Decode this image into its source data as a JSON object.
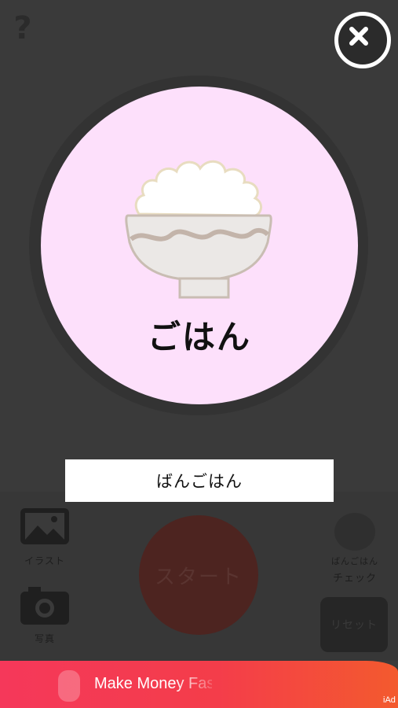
{
  "header": {
    "help_symbol": "?",
    "close_icon": "close-icon"
  },
  "card": {
    "word": "ごはん",
    "image": "rice-bowl-illustration",
    "background": "#fde0fb"
  },
  "answer_box": {
    "text": "ばんごはん"
  },
  "controls": {
    "illustration_label": "イラスト",
    "photo_label": "写真",
    "start_label": "スタート",
    "check_sub_label": "ばんごはん",
    "check_label": "チェック",
    "reset_label": "リセット"
  },
  "ad": {
    "text": "Make Money Fast",
    "iad_label": "iAd"
  },
  "colors": {
    "background": "#3a3a3a",
    "start_button": "#4d2420",
    "ad_banner": "#f43d4a"
  }
}
